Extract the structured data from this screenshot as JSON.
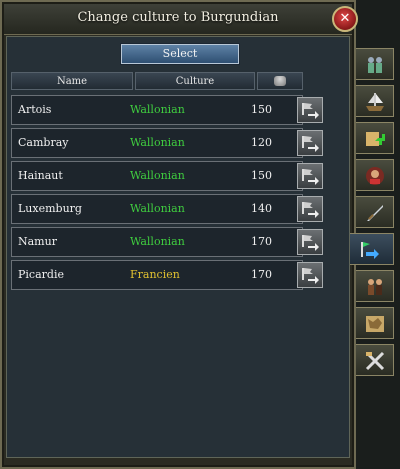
{
  "window": {
    "title": "Change culture to Burgundian",
    "close_glyph": "✕"
  },
  "toolbar": {
    "select_label": "Select"
  },
  "table": {
    "headers": {
      "name": "Name",
      "culture": "Culture",
      "cost_icon": "coin-stack-icon"
    },
    "rows": [
      {
        "name": "Artois",
        "culture": "Wallonian",
        "cost": "150",
        "culture_color": "#3fcc3f"
      },
      {
        "name": "Cambray",
        "culture": "Wallonian",
        "cost": "120",
        "culture_color": "#3fcc3f"
      },
      {
        "name": "Hainaut",
        "culture": "Wallonian",
        "cost": "150",
        "culture_color": "#3fcc3f"
      },
      {
        "name": "Luxemburg",
        "culture": "Wallonian",
        "cost": "140",
        "culture_color": "#3fcc3f"
      },
      {
        "name": "Namur",
        "culture": "Wallonian",
        "cost": "170",
        "culture_color": "#3fcc3f"
      },
      {
        "name": "Picardie",
        "culture": "Francien",
        "cost": "170",
        "culture_color": "#e0c030"
      }
    ],
    "row_action_icon": "change-culture-icon"
  },
  "side_tabs": [
    {
      "icon": "soldiers-icon",
      "active": false
    },
    {
      "icon": "ship-icon",
      "active": false
    },
    {
      "icon": "scroll-plus-icon",
      "active": false
    },
    {
      "icon": "portrait-icon",
      "active": false
    },
    {
      "icon": "sword-icon",
      "active": false
    },
    {
      "icon": "culture-flags-icon",
      "active": true
    },
    {
      "icon": "people-icon",
      "active": false
    },
    {
      "icon": "map-icon",
      "active": false
    },
    {
      "icon": "crossed-tools-icon",
      "active": false
    }
  ]
}
